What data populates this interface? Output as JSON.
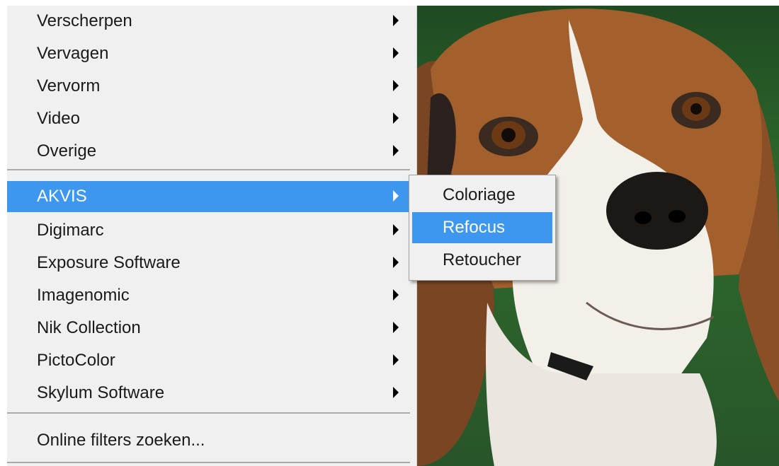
{
  "main_menu": {
    "items": [
      {
        "label": "Verscherpen",
        "has_submenu": true
      },
      {
        "label": "Vervagen",
        "has_submenu": true
      },
      {
        "label": "Vervorm",
        "has_submenu": true
      },
      {
        "label": "Video",
        "has_submenu": true
      },
      {
        "label": "Overige",
        "has_submenu": true
      },
      {
        "label": "AKVIS",
        "has_submenu": true,
        "state": "highlighted"
      },
      {
        "label": "Digimarc",
        "has_submenu": true
      },
      {
        "label": "Exposure Software",
        "has_submenu": true
      },
      {
        "label": "Imagenomic",
        "has_submenu": true
      },
      {
        "label": "Nik Collection",
        "has_submenu": true
      },
      {
        "label": "PictoColor",
        "has_submenu": true
      },
      {
        "label": "Skylum Software",
        "has_submenu": true
      },
      {
        "label": "Online filters zoeken...",
        "has_submenu": false
      }
    ]
  },
  "submenu": {
    "items": [
      {
        "label": "Coloriage"
      },
      {
        "label": "Refocus",
        "state": "highlighted"
      },
      {
        "label": "Retoucher"
      }
    ]
  },
  "colors": {
    "menu_background": "#f0f0f0",
    "highlight": "#3d97ef",
    "separator": "#a9a9a9"
  },
  "background_image": {
    "subject": "beagle dog portrait"
  }
}
